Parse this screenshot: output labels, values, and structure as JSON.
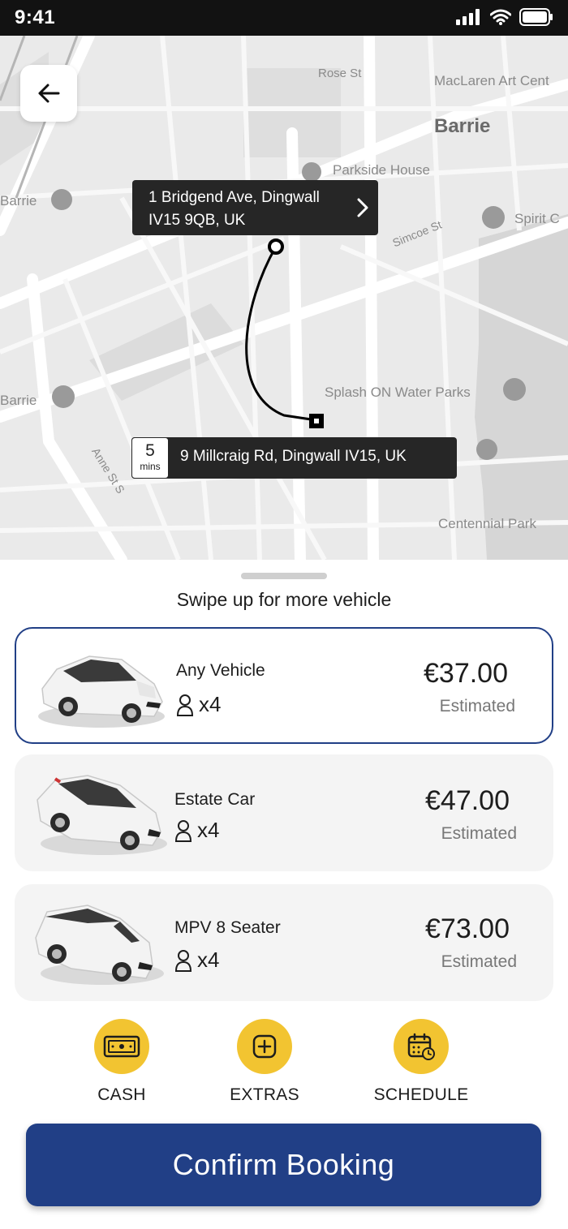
{
  "status_bar": {
    "time": "9:41"
  },
  "map": {
    "labels": {
      "rose_st": "Rose St",
      "maclaren": "MacLaren Art Cent",
      "barrie_city": "Barrie",
      "parkside": "Parkside House",
      "barrie_left_top": "Barrie",
      "spirit": "Spirit C",
      "simcoe": "Simcoe St",
      "barrie_left_mid": "Barrie",
      "splash": "Splash ON Water Parks",
      "anne": "Anne St S",
      "centennial": "Centennial Park"
    },
    "pickup": {
      "line1": "1 Bridgend Ave, Dingwall",
      "line2": "IV15 9QB, UK"
    },
    "dropoff": {
      "address": "9 Millcraig Rd, Dingwall IV15, UK",
      "eta_value": "5",
      "eta_unit": "mins"
    }
  },
  "sheet": {
    "swipe_hint": "Swipe up for more vehicle",
    "vehicles": [
      {
        "name": "Any Vehicle",
        "seats": "x4",
        "price": "€37.00",
        "price_note": "Estimated",
        "selected": true
      },
      {
        "name": "Estate Car",
        "seats": "x4",
        "price": "€47.00",
        "price_note": "Estimated",
        "selected": false
      },
      {
        "name": "MPV 8 Seater",
        "seats": "x4",
        "price": "€73.00",
        "price_note": "Estimated",
        "selected": false
      }
    ],
    "actions": [
      {
        "label": "CASH",
        "icon": "cash-icon"
      },
      {
        "label": "EXTRAS",
        "icon": "plus-square-icon"
      },
      {
        "label": "SCHEDULE",
        "icon": "calendar-clock-icon"
      }
    ],
    "confirm_label": "Confirm Booking"
  },
  "colors": {
    "primary": "#213f86",
    "accent": "#f2c431",
    "tag_bg": "#262626",
    "map_bg": "#eaeaea"
  }
}
